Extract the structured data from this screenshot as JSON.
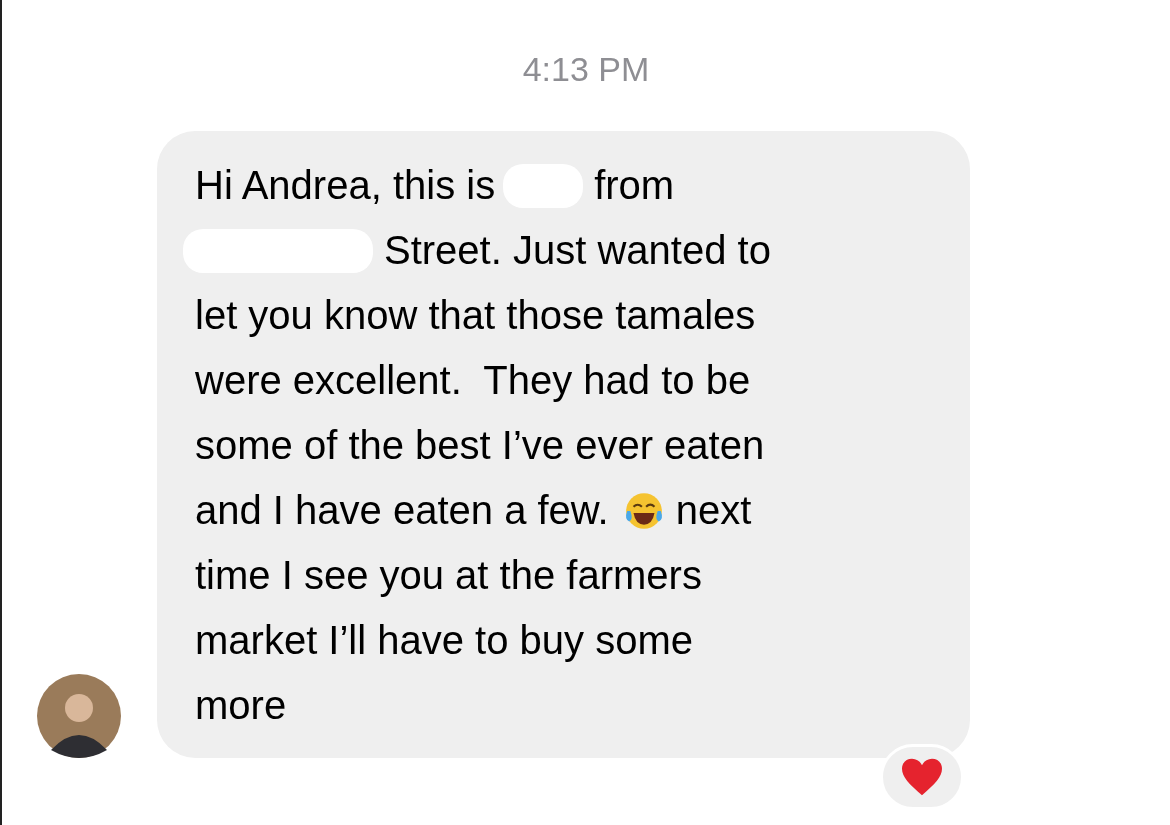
{
  "timestamp": "4:13 PM",
  "message": {
    "lines": [
      {
        "segments": [
          {
            "kind": "text",
            "text": "Hi Andrea, this is"
          },
          {
            "kind": "redaction"
          },
          {
            "kind": "text",
            "text": "from"
          }
        ]
      },
      {
        "segments": [
          {
            "kind": "redaction"
          },
          {
            "kind": "text",
            "text": "Street. Just wanted to"
          }
        ]
      },
      {
        "segments": [
          {
            "kind": "text",
            "text": "let you know that those tamales"
          }
        ]
      },
      {
        "segments": [
          {
            "kind": "text",
            "text": "were excellent.  They had to be"
          }
        ]
      },
      {
        "segments": [
          {
            "kind": "text",
            "text": "some of the best I’ve ever eaten"
          }
        ]
      },
      {
        "segments": [
          {
            "kind": "text",
            "text": "and I have eaten a few."
          },
          {
            "kind": "emoji"
          },
          {
            "kind": "text",
            "text": "next"
          }
        ]
      },
      {
        "segments": [
          {
            "kind": "text",
            "text": "time I see you at the farmers"
          }
        ]
      },
      {
        "segments": [
          {
            "kind": "text",
            "text": "market I’ll have to buy some"
          }
        ]
      },
      {
        "segments": [
          {
            "kind": "text",
            "text": "more"
          }
        ]
      }
    ],
    "reaction": {
      "kind": "heart"
    }
  }
}
